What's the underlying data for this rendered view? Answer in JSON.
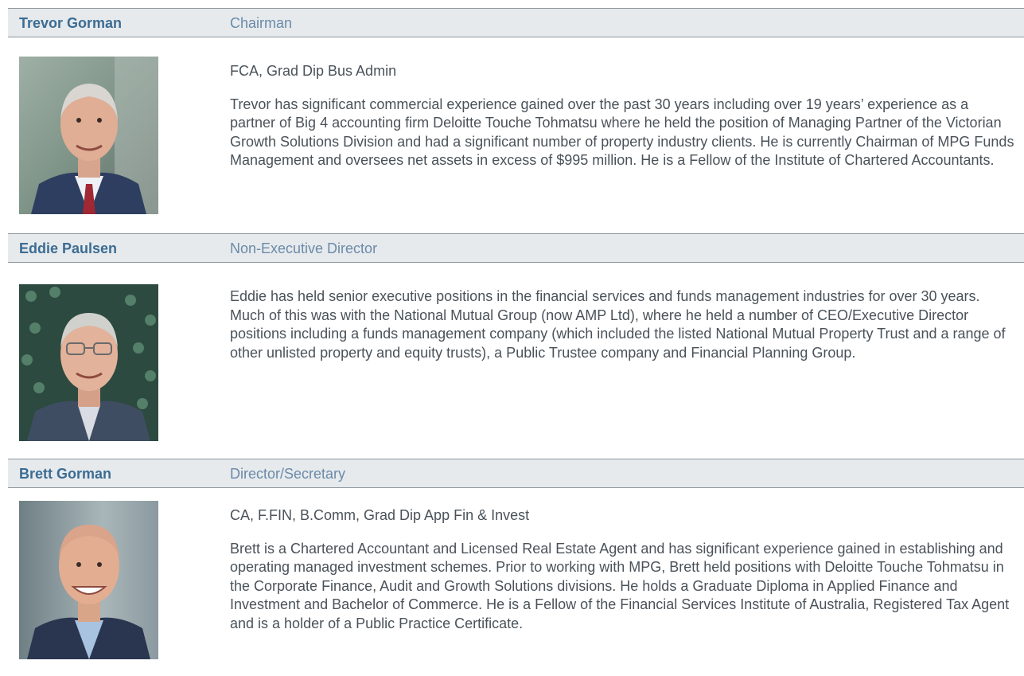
{
  "directors": [
    {
      "name": "Trevor Gorman",
      "role": "Chairman",
      "qualifications": "FCA, Grad Dip Bus Admin",
      "bio": "Trevor has significant commercial experience gained over the past 30 years including over 19 years’ experience as a partner of Big 4 accounting firm Deloitte Touche Tohmatsu where he held the position of Managing Partner of the Victorian Growth Solutions Division and had a significant number of property industry clients. He is currently Chairman of MPG Funds Management and oversees net assets in excess of $995 million. He is a Fellow of the Institute of Chartered Accountants."
    },
    {
      "name": "Eddie Paulsen",
      "role": "Non-Executive Director",
      "bio": "Eddie has held senior executive positions in the financial services and funds management industries for over 30 years. Much of this was with the National Mutual Group (now AMP Ltd), where he held a number of CEO/Executive Director positions including a funds management company (which included the listed National Mutual Property Trust and a range of other unlisted property and equity trusts), a Public Trustee company and Financial Planning Group."
    },
    {
      "name": "Brett Gorman",
      "role": "Director/Secretary",
      "qualifications": "CA, F.FIN, B.Comm, Grad Dip App Fin & Invest",
      "bio": "Brett is a Chartered Accountant and Licensed Real Estate Agent and has significant experience gained in establishing and operating managed investment schemes. Prior to working with MPG, Brett held positions with Deloitte Touche Tohmatsu in the Corporate Finance, Audit and Growth Solutions divisions. He holds a Graduate Diploma in Applied Finance and Investment and Bachelor of Commerce. He is a Fellow of the Financial Services Institute of Australia, Registered Tax Agent and is a holder of a Public Practice Certificate."
    }
  ],
  "colors": {
    "header_bg": "#e6eaed",
    "name": "#3c6c93",
    "role": "#6b8aa8",
    "body_text": "#4a5259",
    "rule": "#8d969d"
  }
}
